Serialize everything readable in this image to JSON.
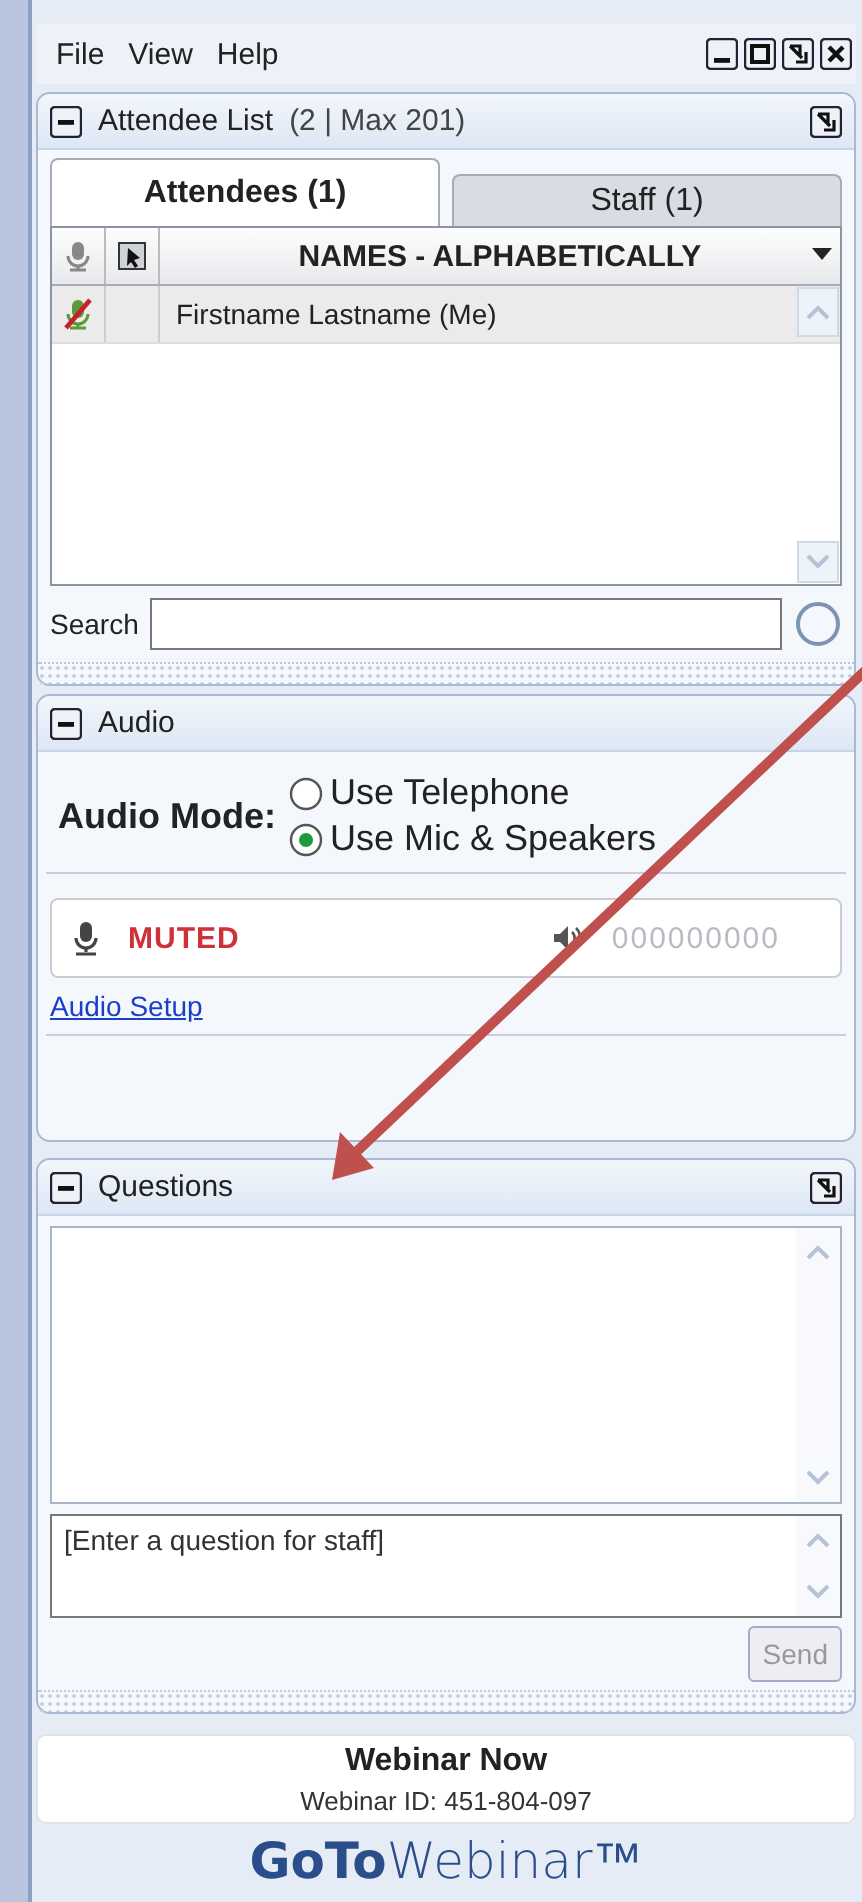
{
  "menu": [
    "File",
    "View",
    "Help"
  ],
  "attendee_panel": {
    "title": "Attendee List",
    "count": "(2 | Max 201)",
    "tabs": [
      {
        "label": "Attendees (1)",
        "selected": true
      },
      {
        "label": "Staff (1)",
        "selected": false
      }
    ],
    "column_header": "NAMES - ALPHABETICALLY",
    "rows": [
      {
        "name": "Firstname Lastname (Me)",
        "muted": true,
        "selected": true
      }
    ],
    "search_label": "Search"
  },
  "audio_panel": {
    "title": "Audio",
    "mode_label": "Audio Mode:",
    "options": [
      {
        "label": "Use Telephone",
        "selected": false
      },
      {
        "label": "Use Mic & Speakers",
        "selected": true
      }
    ],
    "mic_status": "MUTED",
    "speaker_reading": "000000000",
    "setup_link": "Audio Setup"
  },
  "questions_panel": {
    "title": "Questions",
    "placeholder": "[Enter a question for staff]",
    "send": {
      "label": "Send",
      "disabled": true
    }
  },
  "footer": {
    "title": "Webinar Now",
    "webinar_id": "Webinar ID: 451-804-097",
    "logo": "**GoTo**Webinar™"
  }
}
